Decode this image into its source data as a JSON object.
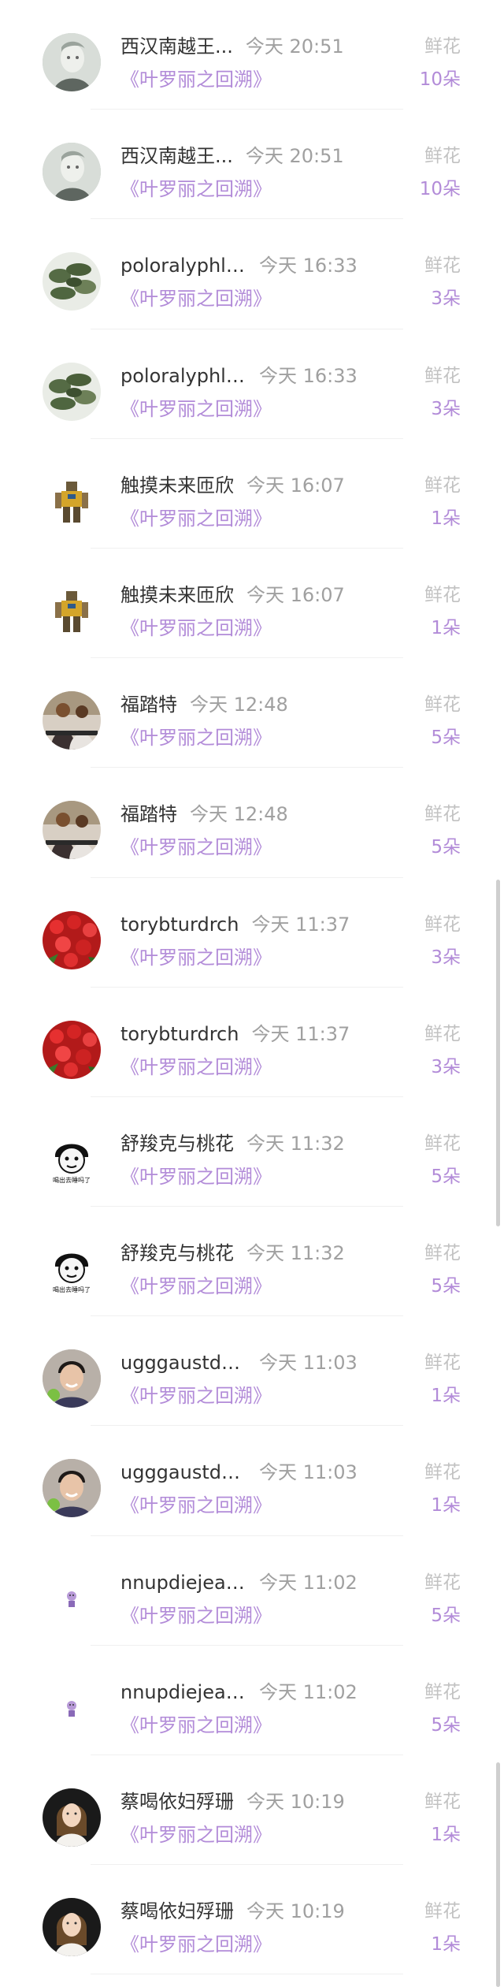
{
  "rows": [
    {
      "name": "西汉南越王...",
      "time": "今天 20:51",
      "title": "《叶罗丽之回溯》",
      "gift": "鲜花",
      "count": "10朵",
      "avatar": "sculpture-avatar"
    },
    {
      "name": "西汉南越王...",
      "time": "今天 20:51",
      "title": "《叶罗丽之回溯》",
      "gift": "鲜花",
      "count": "10朵",
      "avatar": "sculpture-avatar"
    },
    {
      "name": "poloralyphla...",
      "time": "今天 16:33",
      "title": "《叶罗丽之回溯》",
      "gift": "鲜花",
      "count": "3朵",
      "avatar": "plants-avatar"
    },
    {
      "name": "poloralyphla...",
      "time": "今天 16:33",
      "title": "《叶罗丽之回溯》",
      "gift": "鲜花",
      "count": "3朵",
      "avatar": "plants-avatar"
    },
    {
      "name": "触摸未来匝欣",
      "time": "今天 16:07",
      "title": "《叶罗丽之回溯》",
      "gift": "鲜花",
      "count": "1朵",
      "avatar": "robot-avatar"
    },
    {
      "name": "触摸未来匝欣",
      "time": "今天 16:07",
      "title": "《叶罗丽之回溯》",
      "gift": "鲜花",
      "count": "1朵",
      "avatar": "robot-avatar"
    },
    {
      "name": "福踏特",
      "time": "今天 12:48",
      "title": "《叶罗丽之回溯》",
      "gift": "鲜花",
      "count": "5朵",
      "avatar": "people-avatar"
    },
    {
      "name": "福踏特",
      "time": "今天 12:48",
      "title": "《叶罗丽之回溯》",
      "gift": "鲜花",
      "count": "5朵",
      "avatar": "people-avatar"
    },
    {
      "name": "torybturdrch",
      "time": "今天 11:37",
      "title": "《叶罗丽之回溯》",
      "gift": "鲜花",
      "count": "3朵",
      "avatar": "red-flowers-avatar"
    },
    {
      "name": "torybturdrch",
      "time": "今天 11:37",
      "title": "《叶罗丽之回溯》",
      "gift": "鲜花",
      "count": "3朵",
      "avatar": "red-flowers-avatar"
    },
    {
      "name": "舒羧克与桃花",
      "time": "今天 11:32",
      "title": "《叶罗丽之回溯》",
      "gift": "鲜花",
      "count": "5朵",
      "avatar": "meme-avatar",
      "meme_text": "喝出去睡吗了"
    },
    {
      "name": "舒羧克与桃花",
      "time": "今天 11:32",
      "title": "《叶罗丽之回溯》",
      "gift": "鲜花",
      "count": "5朵",
      "avatar": "meme-avatar",
      "meme_text": "喝出去睡吗了"
    },
    {
      "name": "ugggaustdra...",
      "time": "今天 11:03",
      "title": "《叶罗丽之回溯》",
      "gift": "鲜花",
      "count": "1朵",
      "avatar": "smiling-man-avatar"
    },
    {
      "name": "ugggaustdra...",
      "time": "今天 11:03",
      "title": "《叶罗丽之回溯》",
      "gift": "鲜花",
      "count": "1朵",
      "avatar": "smiling-man-avatar"
    },
    {
      "name": "nnupdiejeans",
      "time": "今天 11:02",
      "title": "《叶罗丽之回溯》",
      "gift": "鲜花",
      "count": "5朵",
      "avatar": "small-character-avatar"
    },
    {
      "name": "nnupdiejeans",
      "time": "今天 11:02",
      "title": "《叶罗丽之回溯》",
      "gift": "鲜花",
      "count": "5朵",
      "avatar": "small-character-avatar"
    },
    {
      "name": "蔡喝依妇殍珊",
      "time": "今天 10:19",
      "title": "《叶罗丽之回溯》",
      "gift": "鲜花",
      "count": "1朵",
      "avatar": "woman-avatar"
    },
    {
      "name": "蔡喝依妇殍珊",
      "time": "今天 10:19",
      "title": "《叶罗丽之回溯》",
      "gift": "鲜花",
      "count": "1朵",
      "avatar": "woman-avatar"
    }
  ],
  "colors": {
    "accent": "#b28bd8",
    "muted": "#c2c2c2",
    "name": "#333333",
    "time": "#a0a0a0"
  }
}
